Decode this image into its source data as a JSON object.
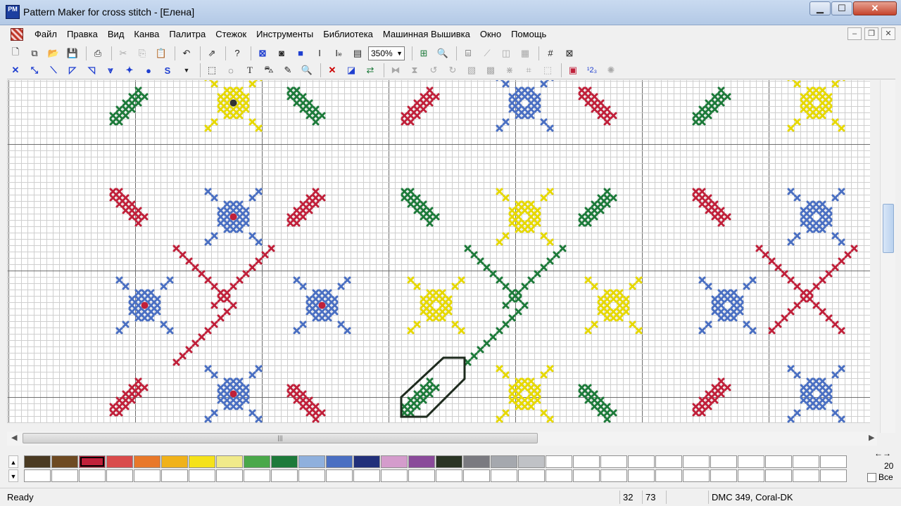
{
  "window": {
    "app_icon_text": "PM",
    "title": "Pattern Maker for cross stitch - [Елена]",
    "min_symbol": "▁",
    "max_symbol": "☐",
    "close_symbol": "✕"
  },
  "menu": {
    "items": [
      {
        "label": "Файл"
      },
      {
        "label": "Правка"
      },
      {
        "label": "Вид"
      },
      {
        "label": "Канва"
      },
      {
        "label": "Палитра"
      },
      {
        "label": "Стежок"
      },
      {
        "label": "Инструменты"
      },
      {
        "label": "Библиотека"
      },
      {
        "label": "Машинная Вышивка"
      },
      {
        "label": "Окно"
      },
      {
        "label": "Помощь"
      }
    ],
    "mdi_min": "–",
    "mdi_restore": "❐",
    "mdi_close": "✕"
  },
  "toolbar": {
    "zoom_value": "350%",
    "zoom_arrow": "▼"
  },
  "canvas": {
    "colors": {
      "red": "#c0203a",
      "green": "#1d7a3a",
      "blue": "#4a6fc2",
      "yellow": "#e6d800",
      "grid_minor": "#cfcfcf",
      "grid_major": "#6e6e6e",
      "outline": "#1e2b1e"
    }
  },
  "scroll": {
    "h_left": "◀",
    "h_right": "▶",
    "h_thumb_grip": "|||"
  },
  "palette": {
    "up": "▲",
    "down": "▼",
    "row1": [
      "#4a3a22",
      "#6e4a22",
      "#c0203a",
      "#d94b4b",
      "#e8782a",
      "#f0b21a",
      "#f5e21a",
      "#f0ea8a",
      "#4aa84a",
      "#1d7a3a",
      "#8fb0dd",
      "#4a6fc2",
      "#22307a",
      "#d49ccc",
      "#8a4a9a",
      "#2a3424",
      "#7a7a80",
      "#a5a8ae",
      "#c0c2c6",
      "#ffffff",
      "#ffffff",
      "#ffffff",
      "#ffffff",
      "#ffffff",
      "#ffffff",
      "#ffffff",
      "#ffffff",
      "#ffffff",
      "#ffffff",
      "#ffffff"
    ],
    "selected_index": 2,
    "right_number": "20",
    "nav_arrows": "←→",
    "all_label": "Все"
  },
  "status": {
    "ready": "Ready",
    "x": "32",
    "y": "73",
    "thread": "DMC  349, Coral-DK"
  }
}
